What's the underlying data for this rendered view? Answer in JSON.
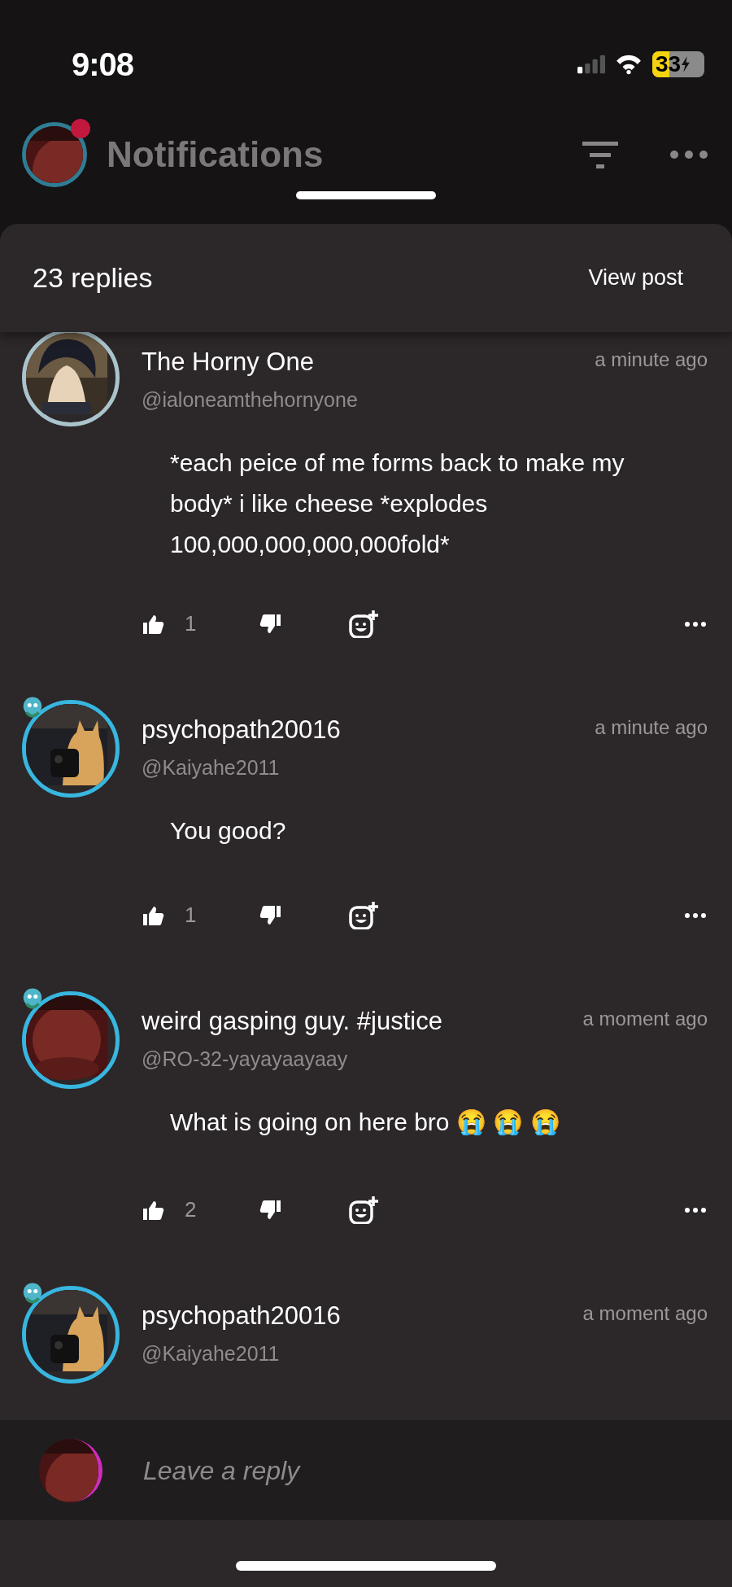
{
  "status_bar": {
    "time": "9:08",
    "battery": "33"
  },
  "header": {
    "title": "Notifications",
    "unread_dot": true
  },
  "sheet": {
    "count": "23 replies",
    "view_post": "View post"
  },
  "comments": [
    {
      "name": "The Horny One",
      "handle": "@ialoneamthehornyone",
      "time": "a minute ago",
      "body": "*each peice of me forms back to make my body* i like cheese *explodes 100,000,000,000,000fold*",
      "likes": "1",
      "color": "#a9c4cc",
      "sticker": false
    },
    {
      "name": "psychopath20016",
      "handle": "@Kaiyahe2011",
      "time": "a minute ago",
      "body": "You good?",
      "likes": "1",
      "color": "#38b6e0",
      "sticker": true
    },
    {
      "name": "weird gasping guy. #justice",
      "handle": "@RO-32-yayayaayaay",
      "time": "a moment ago",
      "body": "What is going on here bro 😭 😭 😭",
      "likes": "2",
      "color": "#38b6e0",
      "sticker": true
    },
    {
      "name": "psychopath20016",
      "handle": "@Kaiyahe2011",
      "time": "a moment ago",
      "color": "#38b6e0",
      "sticker": true
    }
  ],
  "reply_bar": {
    "placeholder": "Leave a reply"
  }
}
